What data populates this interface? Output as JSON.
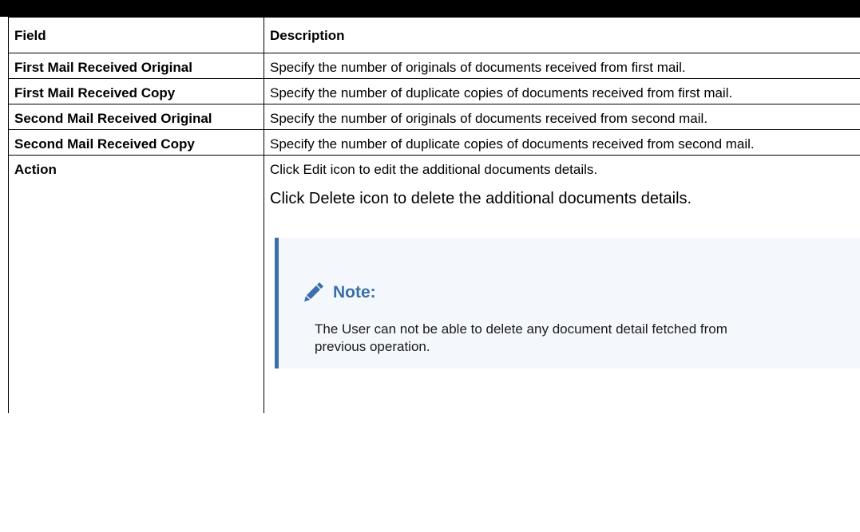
{
  "table": {
    "headers": [
      "Field",
      "Description"
    ],
    "rows": [
      {
        "field": "First Mail Received Original",
        "description": "Specify the number of originals of documents received from first mail."
      },
      {
        "field": "First Mail Received Copy",
        "description": "Specify the number of duplicate copies of documents received from first mail."
      },
      {
        "field": "Second Mail Received Original",
        "description": "Specify the number of originals of documents received from second mail."
      },
      {
        "field": "Second Mail Received Copy",
        "description": "Specify the number of duplicate copies of documents received from second mail."
      }
    ],
    "action": {
      "field": "Action",
      "para1": "Click Edit icon to edit the additional documents details.",
      "para2": "Click Delete icon to delete the additional documents details.",
      "note": {
        "icon": "pencil-icon",
        "title": "Note:",
        "text": "The User can not be able to delete any document detail fetched from previous operation.",
        "accent_color": "#3c6ea9",
        "background_color": "#f4f7fb"
      }
    }
  }
}
